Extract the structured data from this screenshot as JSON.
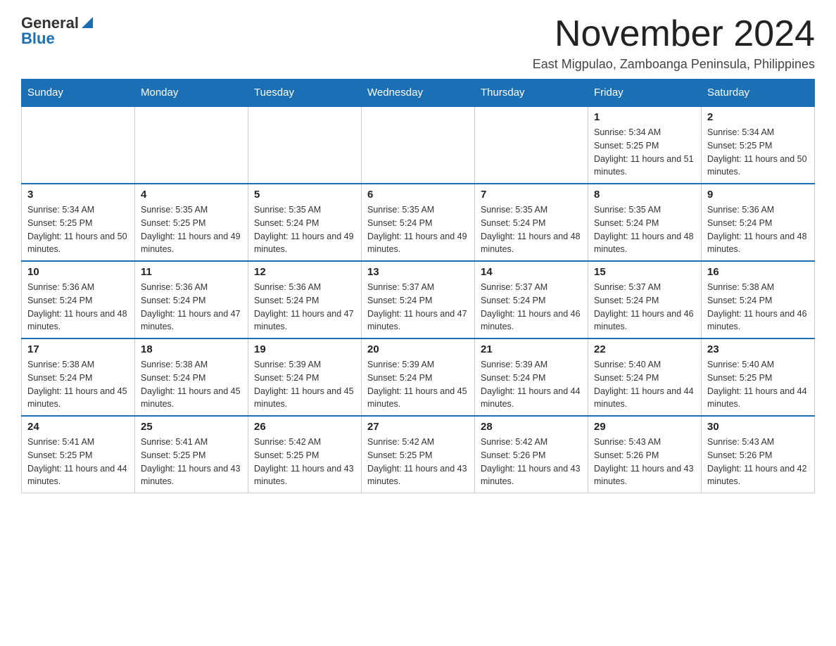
{
  "header": {
    "logo": {
      "general": "General",
      "blue": "Blue"
    },
    "month_title": "November 2024",
    "location": "East Migpulao, Zamboanga Peninsula, Philippines"
  },
  "calendar": {
    "days_of_week": [
      "Sunday",
      "Monday",
      "Tuesday",
      "Wednesday",
      "Thursday",
      "Friday",
      "Saturday"
    ],
    "weeks": [
      [
        {
          "day": "",
          "info": ""
        },
        {
          "day": "",
          "info": ""
        },
        {
          "day": "",
          "info": ""
        },
        {
          "day": "",
          "info": ""
        },
        {
          "day": "",
          "info": ""
        },
        {
          "day": "1",
          "info": "Sunrise: 5:34 AM\nSunset: 5:25 PM\nDaylight: 11 hours and 51 minutes."
        },
        {
          "day": "2",
          "info": "Sunrise: 5:34 AM\nSunset: 5:25 PM\nDaylight: 11 hours and 50 minutes."
        }
      ],
      [
        {
          "day": "3",
          "info": "Sunrise: 5:34 AM\nSunset: 5:25 PM\nDaylight: 11 hours and 50 minutes."
        },
        {
          "day": "4",
          "info": "Sunrise: 5:35 AM\nSunset: 5:25 PM\nDaylight: 11 hours and 49 minutes."
        },
        {
          "day": "5",
          "info": "Sunrise: 5:35 AM\nSunset: 5:24 PM\nDaylight: 11 hours and 49 minutes."
        },
        {
          "day": "6",
          "info": "Sunrise: 5:35 AM\nSunset: 5:24 PM\nDaylight: 11 hours and 49 minutes."
        },
        {
          "day": "7",
          "info": "Sunrise: 5:35 AM\nSunset: 5:24 PM\nDaylight: 11 hours and 48 minutes."
        },
        {
          "day": "8",
          "info": "Sunrise: 5:35 AM\nSunset: 5:24 PM\nDaylight: 11 hours and 48 minutes."
        },
        {
          "day": "9",
          "info": "Sunrise: 5:36 AM\nSunset: 5:24 PM\nDaylight: 11 hours and 48 minutes."
        }
      ],
      [
        {
          "day": "10",
          "info": "Sunrise: 5:36 AM\nSunset: 5:24 PM\nDaylight: 11 hours and 48 minutes."
        },
        {
          "day": "11",
          "info": "Sunrise: 5:36 AM\nSunset: 5:24 PM\nDaylight: 11 hours and 47 minutes."
        },
        {
          "day": "12",
          "info": "Sunrise: 5:36 AM\nSunset: 5:24 PM\nDaylight: 11 hours and 47 minutes."
        },
        {
          "day": "13",
          "info": "Sunrise: 5:37 AM\nSunset: 5:24 PM\nDaylight: 11 hours and 47 minutes."
        },
        {
          "day": "14",
          "info": "Sunrise: 5:37 AM\nSunset: 5:24 PM\nDaylight: 11 hours and 46 minutes."
        },
        {
          "day": "15",
          "info": "Sunrise: 5:37 AM\nSunset: 5:24 PM\nDaylight: 11 hours and 46 minutes."
        },
        {
          "day": "16",
          "info": "Sunrise: 5:38 AM\nSunset: 5:24 PM\nDaylight: 11 hours and 46 minutes."
        }
      ],
      [
        {
          "day": "17",
          "info": "Sunrise: 5:38 AM\nSunset: 5:24 PM\nDaylight: 11 hours and 45 minutes."
        },
        {
          "day": "18",
          "info": "Sunrise: 5:38 AM\nSunset: 5:24 PM\nDaylight: 11 hours and 45 minutes."
        },
        {
          "day": "19",
          "info": "Sunrise: 5:39 AM\nSunset: 5:24 PM\nDaylight: 11 hours and 45 minutes."
        },
        {
          "day": "20",
          "info": "Sunrise: 5:39 AM\nSunset: 5:24 PM\nDaylight: 11 hours and 45 minutes."
        },
        {
          "day": "21",
          "info": "Sunrise: 5:39 AM\nSunset: 5:24 PM\nDaylight: 11 hours and 44 minutes."
        },
        {
          "day": "22",
          "info": "Sunrise: 5:40 AM\nSunset: 5:24 PM\nDaylight: 11 hours and 44 minutes."
        },
        {
          "day": "23",
          "info": "Sunrise: 5:40 AM\nSunset: 5:25 PM\nDaylight: 11 hours and 44 minutes."
        }
      ],
      [
        {
          "day": "24",
          "info": "Sunrise: 5:41 AM\nSunset: 5:25 PM\nDaylight: 11 hours and 44 minutes."
        },
        {
          "day": "25",
          "info": "Sunrise: 5:41 AM\nSunset: 5:25 PM\nDaylight: 11 hours and 43 minutes."
        },
        {
          "day": "26",
          "info": "Sunrise: 5:42 AM\nSunset: 5:25 PM\nDaylight: 11 hours and 43 minutes."
        },
        {
          "day": "27",
          "info": "Sunrise: 5:42 AM\nSunset: 5:25 PM\nDaylight: 11 hours and 43 minutes."
        },
        {
          "day": "28",
          "info": "Sunrise: 5:42 AM\nSunset: 5:26 PM\nDaylight: 11 hours and 43 minutes."
        },
        {
          "day": "29",
          "info": "Sunrise: 5:43 AM\nSunset: 5:26 PM\nDaylight: 11 hours and 43 minutes."
        },
        {
          "day": "30",
          "info": "Sunrise: 5:43 AM\nSunset: 5:26 PM\nDaylight: 11 hours and 42 minutes."
        }
      ]
    ]
  }
}
